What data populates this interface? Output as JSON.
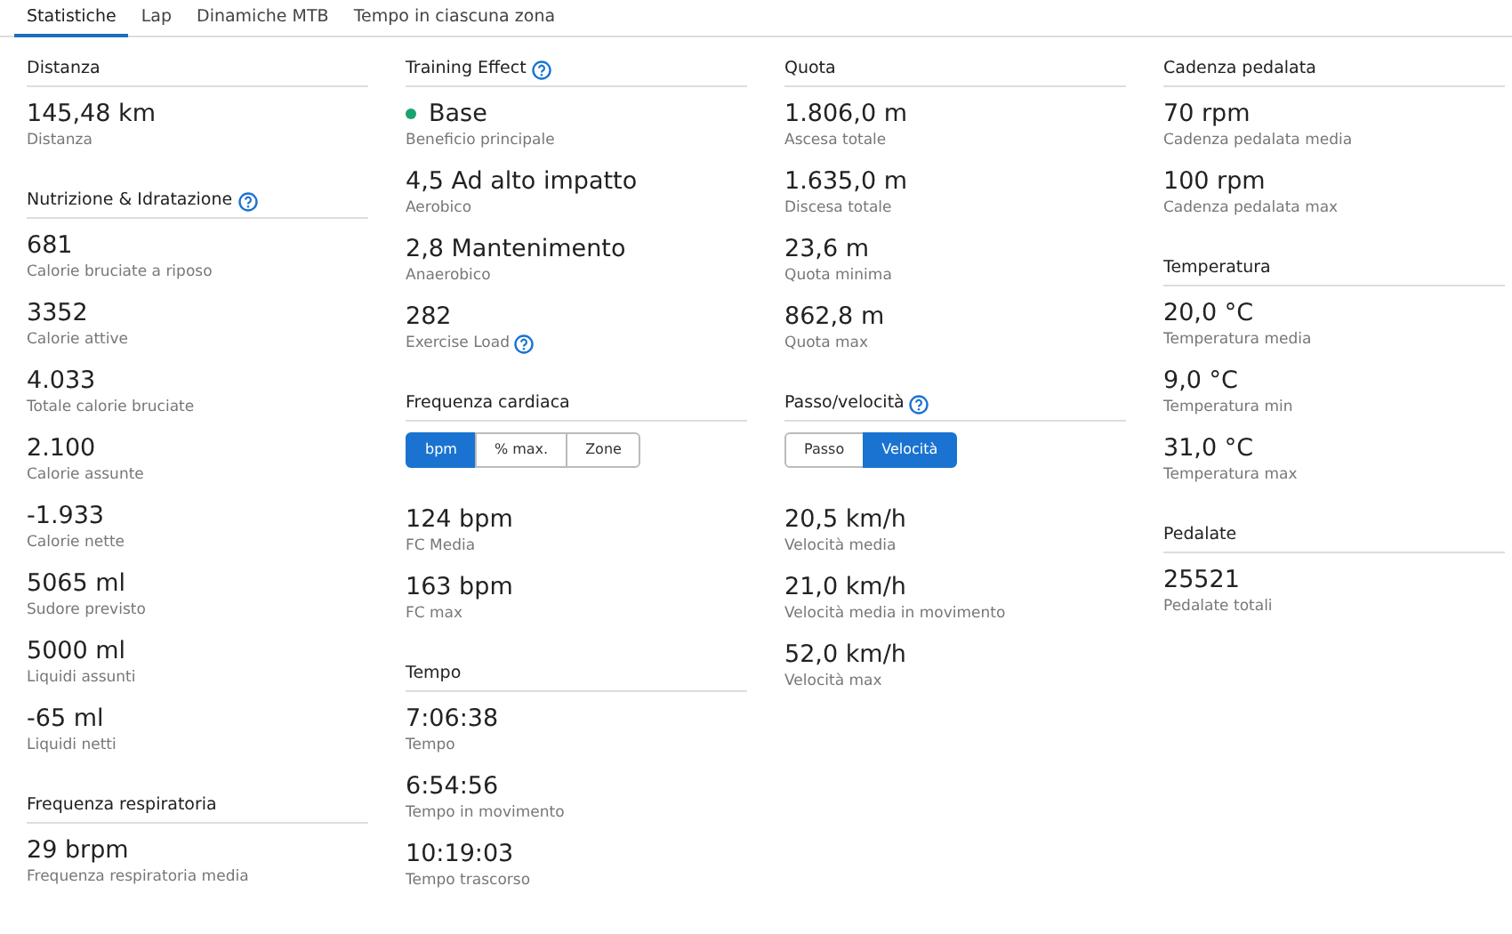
{
  "tabs": [
    {
      "label": "Statistiche",
      "selected": true
    },
    {
      "label": "Lap",
      "selected": false
    },
    {
      "label": "Dinamiche MTB",
      "selected": false
    },
    {
      "label": "Tempo in ciascuna zona",
      "selected": false
    }
  ],
  "columns": [
    {
      "sections": [
        {
          "title": "Distanza",
          "help": false,
          "stats": [
            {
              "value": "145,48 km",
              "label": "Distanza"
            }
          ]
        },
        {
          "title": "Nutrizione & Idratazione",
          "help": true,
          "stats": [
            {
              "value": "681",
              "label": "Calorie bruciate a riposo"
            },
            {
              "value": "3352",
              "label": "Calorie attive"
            },
            {
              "value": "4.033",
              "label": "Totale calorie bruciate"
            },
            {
              "value": "2.100",
              "label": "Calorie assunte"
            },
            {
              "value": "-1.933",
              "label": "Calorie nette"
            },
            {
              "value": "5065 ml",
              "label": "Sudore previsto"
            },
            {
              "value": "5000 ml",
              "label": "Liquidi assunti"
            },
            {
              "value": "-65 ml",
              "label": "Liquidi netti"
            }
          ]
        },
        {
          "title": "Frequenza respiratoria",
          "help": false,
          "stats": [
            {
              "value": "29 brpm",
              "label": "Frequenza respiratoria media"
            }
          ]
        }
      ]
    },
    {
      "sections": [
        {
          "title": "Training Effect",
          "help": true,
          "stats": [
            {
              "value": "Base",
              "label": "Beneficio principale",
              "color": "#1ba36f"
            },
            {
              "value": "4,5 Ad alto impatto",
              "label": "Aerobico"
            },
            {
              "value": "2,8 Mantenimento",
              "label": "Anaerobico"
            },
            {
              "value": "282",
              "label": "Exercise Load",
              "help": true
            }
          ]
        },
        {
          "title": "Frequenza cardiaca",
          "help": false,
          "toggle": [
            {
              "label": "bpm",
              "selected": true
            },
            {
              "label": "% max.",
              "selected": false
            },
            {
              "label": "Zone",
              "selected": false
            }
          ],
          "stats": [
            {
              "value": "124 bpm",
              "label": "FC Media"
            },
            {
              "value": "163 bpm",
              "label": "FC max"
            }
          ]
        },
        {
          "title": "Tempo",
          "help": false,
          "stats": [
            {
              "value": "7:06:38",
              "label": "Tempo"
            },
            {
              "value": "6:54:56",
              "label": "Tempo in movimento"
            },
            {
              "value": "10:19:03",
              "label": "Tempo trascorso"
            }
          ]
        }
      ]
    },
    {
      "sections": [
        {
          "title": "Quota",
          "help": false,
          "stats": [
            {
              "value": "1.806,0 m",
              "label": "Ascesa totale"
            },
            {
              "value": "1.635,0 m",
              "label": "Discesa totale"
            },
            {
              "value": "23,6 m",
              "label": "Quota minima"
            },
            {
              "value": "862,8 m",
              "label": "Quota max"
            }
          ]
        },
        {
          "title": "Passo/velocità",
          "help": true,
          "toggle": [
            {
              "label": "Passo",
              "selected": false
            },
            {
              "label": "Velocità",
              "selected": true
            }
          ],
          "stats": [
            {
              "value": "20,5 km/h",
              "label": "Velocità media"
            },
            {
              "value": "21,0 km/h",
              "label": "Velocità media in movimento"
            },
            {
              "value": "52,0 km/h",
              "label": "Velocità max"
            }
          ]
        }
      ]
    },
    {
      "sections": [
        {
          "title": "Cadenza pedalata",
          "help": false,
          "stats": [
            {
              "value": "70 rpm",
              "label": "Cadenza pedalata media"
            },
            {
              "value": "100 rpm",
              "label": "Cadenza pedalata max"
            }
          ]
        },
        {
          "title": "Temperatura",
          "help": false,
          "stats": [
            {
              "value": "20,0 °C",
              "label": "Temperatura media"
            },
            {
              "value": "9,0 °C",
              "label": "Temperatura min"
            },
            {
              "value": "31,0 °C",
              "label": "Temperatura max"
            }
          ]
        },
        {
          "title": "Pedalate",
          "help": false,
          "stats": [
            {
              "value": "25521",
              "label": "Pedalate totali"
            }
          ]
        }
      ]
    }
  ]
}
